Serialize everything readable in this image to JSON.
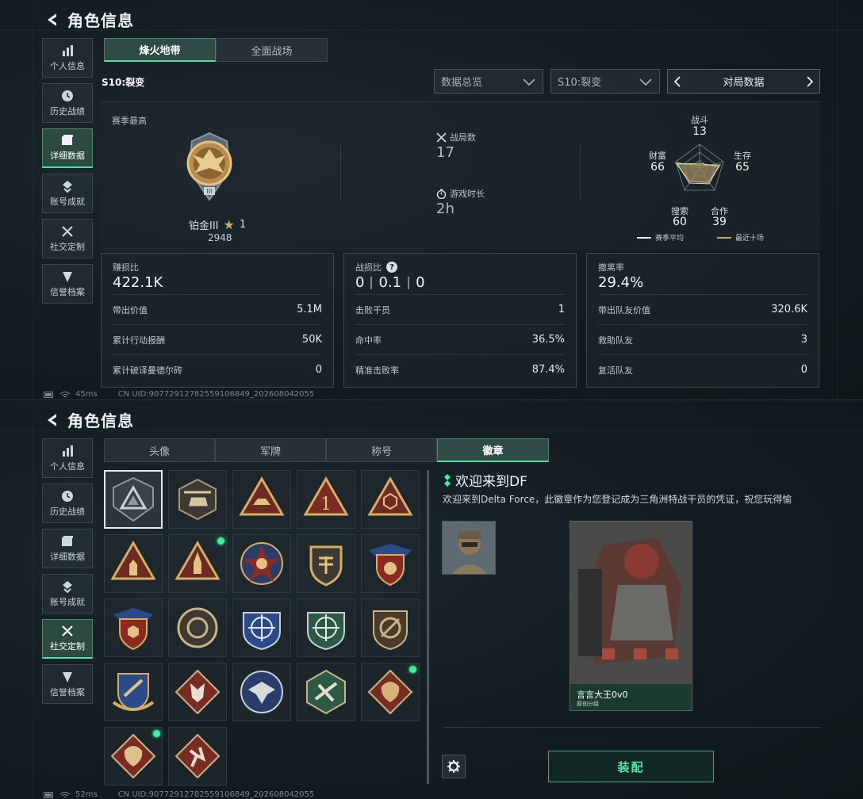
{
  "page_title": "角色信息",
  "sidebar": {
    "items": [
      {
        "label": "个人信息",
        "icon": "bar-chart-icon"
      },
      {
        "label": "历史战绩",
        "icon": "clock-icon"
      },
      {
        "label": "详细数据",
        "icon": "folder-icon"
      },
      {
        "label": "账号成就",
        "icon": "achievement-icon"
      },
      {
        "label": "社交定制",
        "icon": "tools-icon"
      },
      {
        "label": "信誉档案",
        "icon": "shield-icon"
      }
    ]
  },
  "screen1": {
    "active_sidebar": "详细数据",
    "mode_tabs": [
      "烽火地带",
      "全面战场"
    ],
    "active_tab": "烽火地带",
    "season_label": "S10:裂变",
    "filters": {
      "overview": "数据总览",
      "season": "S10:裂变",
      "pager_label": "对局数据"
    },
    "season_best": {
      "label": "赛季最高",
      "rank": "铂金III",
      "stars": "1",
      "score": "2948"
    },
    "matches": {
      "label": "战局数",
      "value": "17"
    },
    "playtime": {
      "label": "游戏时长",
      "value": "2h"
    },
    "radar": {
      "axes": [
        {
          "label": "战斗",
          "value": "13"
        },
        {
          "label": "生存",
          "value": "65"
        },
        {
          "label": "合作",
          "value": "39"
        },
        {
          "label": "搜索",
          "value": "60"
        },
        {
          "label": "财富",
          "value": "66"
        }
      ],
      "legend": [
        {
          "label": "赛季平均",
          "color": "#e8ecee"
        },
        {
          "label": "最近十场",
          "color": "#c8a964"
        }
      ]
    },
    "cards": [
      {
        "head_label": "赚损比",
        "head_value": "422.1K",
        "rows": [
          {
            "label": "带出价值",
            "value": "5.1M"
          },
          {
            "label": "累计行动报酬",
            "value": "50K"
          },
          {
            "label": "累计破译曼德尔砖",
            "value": "0"
          }
        ]
      },
      {
        "head_label": "战损比",
        "ratio": [
          "0",
          "0.1",
          "0"
        ],
        "rows": [
          {
            "label": "击败干员",
            "value": "1"
          },
          {
            "label": "命中率",
            "value": "36.5%"
          },
          {
            "label": "精准击败率",
            "value": "87.4%"
          }
        ]
      },
      {
        "head_label": "撤离率",
        "head_value": "29.4%",
        "rows": [
          {
            "label": "带出队友价值",
            "value": "320.6K"
          },
          {
            "label": "救助队友",
            "value": "3"
          },
          {
            "label": "复活队友",
            "value": "0"
          }
        ]
      }
    ],
    "status": {
      "ping": "45ms",
      "uid": "CN UID:9077291278255910​6849_202608042055"
    }
  },
  "screen2": {
    "active_sidebar": "社交定制",
    "tabs": [
      "头像",
      "军牌",
      "称号",
      "徽章"
    ],
    "active_tab": "徽章",
    "badge_detail": {
      "title": "欢迎来到DF",
      "description": "欢迎来到Delta Force，此徽章作为您登记成为三角洲特战干员的凭证，祝您玩得愉",
      "card_name": "言言大王0v0",
      "card_sub": "原创分组"
    },
    "equip_label": "装配",
    "status": {
      "ping": "52ms",
      "uid": "CN UID:9077291278255910​6849_202608042055"
    }
  },
  "colors": {
    "accent": "#4fe0a5",
    "gold": "#c8a964",
    "badge_red": "#7a2a24",
    "badge_blue": "#2a4a8a",
    "badge_green": "#2d5a44"
  }
}
